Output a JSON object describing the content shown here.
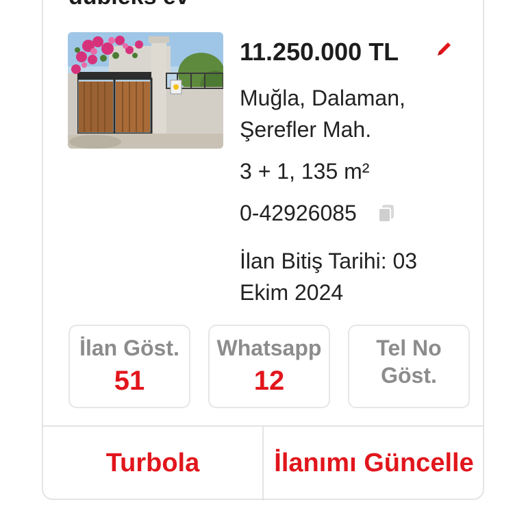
{
  "listing": {
    "title": "dubleks ev",
    "price": "11.250.000 TL",
    "location_line1": "Muğla, Dalaman,",
    "location_line2": "Şerefler Mah.",
    "size": "3 + 1, 135 m²",
    "listing_id": "0-42926085",
    "end_date_line1": "İlan Bitiş Tarihi: 03",
    "end_date_line2": "Ekim 2024"
  },
  "stats": [
    {
      "label": "İlan Göst.",
      "value": "51"
    },
    {
      "label": "Whatsapp",
      "value": "12"
    },
    {
      "label_line1": "Tel No",
      "label_line2": "Göst."
    }
  ],
  "actions": {
    "turbo": "Turbola",
    "update": "İlanımı Güncelle"
  },
  "icons": {
    "edit": "pencil-icon",
    "copy": "copy-icon"
  },
  "colors": {
    "accent": "#e1161c",
    "muted": "#8c8c8c",
    "text": "#1d1d1d",
    "border": "#e4e4e4"
  }
}
